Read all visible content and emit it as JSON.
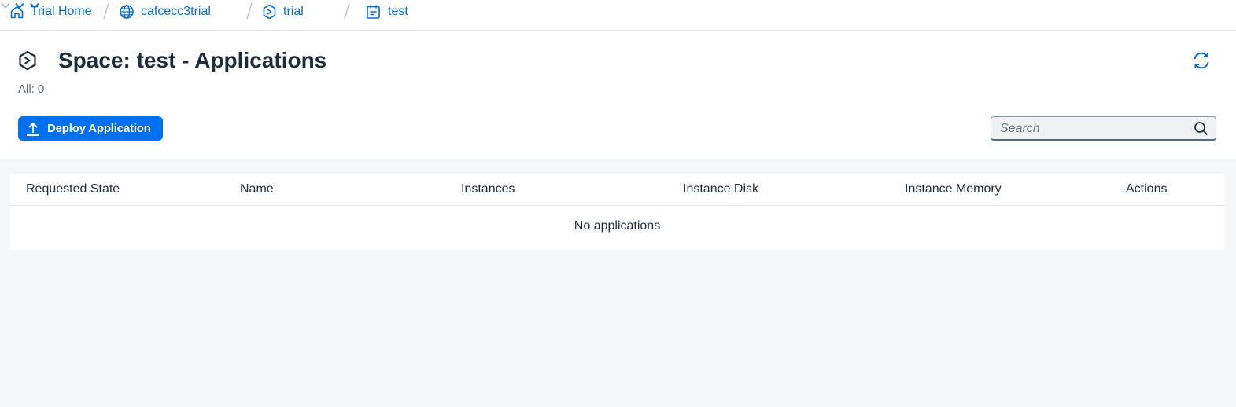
{
  "breadcrumb": {
    "items": [
      {
        "label": "Trial Home",
        "icon": "home-icon"
      },
      {
        "label": "cafcecc3trial",
        "icon": "globe-icon"
      },
      {
        "label": "trial",
        "icon": "org-hexagon-icon"
      },
      {
        "label": "test",
        "icon": "space-calendar-icon"
      }
    ]
  },
  "header": {
    "title": "Space: test - Applications",
    "count": "All: 0"
  },
  "toolbar": {
    "deploy_label": "Deploy Application",
    "search_placeholder": "Search"
  },
  "table": {
    "columns": [
      "Requested State",
      "Name",
      "Instances",
      "Instance Disk",
      "Instance Memory",
      "Actions"
    ],
    "empty_text": "No applications"
  },
  "colors": {
    "accent": "#0070f2",
    "link": "#0a6ed1",
    "text": "#1d2d3e",
    "background": "#f5f6f7"
  }
}
